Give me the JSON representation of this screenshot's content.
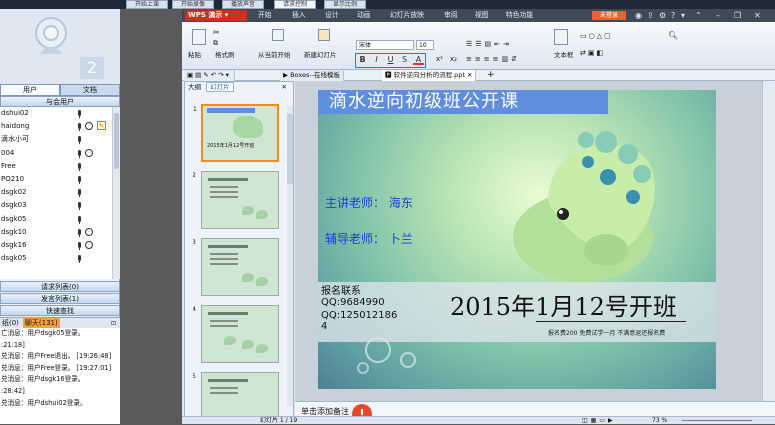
{
  "top_buttons": [
    "开始上课",
    "开始录像",
    "播放声音",
    "请求控制",
    "显示比例"
  ],
  "left": {
    "tabs": [
      "用户",
      "文档"
    ],
    "users_header": "与会用户",
    "users": [
      {
        "name": "dshui02",
        "loc": false,
        "edit": false
      },
      {
        "name": "haidong",
        "loc": true,
        "edit": true
      },
      {
        "name": "滴水小可",
        "loc": false,
        "edit": false
      },
      {
        "name": "004",
        "loc": true,
        "edit": false
      },
      {
        "name": "Free",
        "loc": false,
        "edit": false
      },
      {
        "name": "PO210",
        "loc": false,
        "edit": false
      },
      {
        "name": "dsgk02",
        "loc": false,
        "edit": false
      },
      {
        "name": "dsgk03",
        "loc": false,
        "edit": false
      },
      {
        "name": "dsgk05",
        "loc": false,
        "edit": false
      },
      {
        "name": "dsgk10",
        "loc": true,
        "edit": false
      },
      {
        "name": "dsgk16",
        "loc": true,
        "edit": false
      },
      {
        "name": "dsgk05",
        "loc": false,
        "edit": false
      }
    ],
    "request_list": "请求列表(0)",
    "speak_list": "发言列表(1)",
    "quick_find": "快速查找",
    "chat_tabs": [
      "纸(0)",
      "聊天(131)"
    ],
    "messages": [
      "亡消息：用户dsgk05登录。",
      ":21:18]",
      "兑消息：用户Free退出。   [19:26:48]",
      "兑消息：用户Free登录。   [19:27:01]",
      "兑消息：用户dsgk16登录。",
      ":28:42]",
      "兑消息：用户dshui02登录。"
    ]
  },
  "app": {
    "logo": "WPS 演示",
    "menus": [
      "开始",
      "插入",
      "设计",
      "动画",
      "幻灯片放映",
      "审阅",
      "视图",
      "特色功能"
    ],
    "login": "未登录",
    "ribbon": {
      "paste": "粘贴",
      "format_painter": "格式刷",
      "from_current": "从当前开始",
      "new_slide": "新建幻灯片",
      "font_name": "宋体",
      "font_size": "10",
      "text_box": "文本框",
      "fmt_buttons": [
        "B",
        "I",
        "U",
        "S",
        "A"
      ]
    },
    "doc_tabs": [
      "Boxes--在线模板",
      "软件逆向分析的流程.ppt"
    ],
    "panel_tabs": [
      "大纲",
      "幻灯片"
    ],
    "slide": {
      "title": "滴水逆向初级班公开课",
      "teacher_main": "主讲老师：  海东",
      "teacher_assist": "辅导老师：  卜兰",
      "contact_label": "报名联系",
      "qq1": "QQ:9684990",
      "qq2": "QQ:125012186",
      "qq2_cont": "4",
      "date_text": "2015年1月12号开班",
      "fee": "报名费200  免费试学一月  不满意退还报名费"
    },
    "thumb_date": "2015年1月12号开班",
    "notes": "单击添加备注",
    "status": "幻灯片 1 / 19",
    "zoom": "73 %"
  }
}
